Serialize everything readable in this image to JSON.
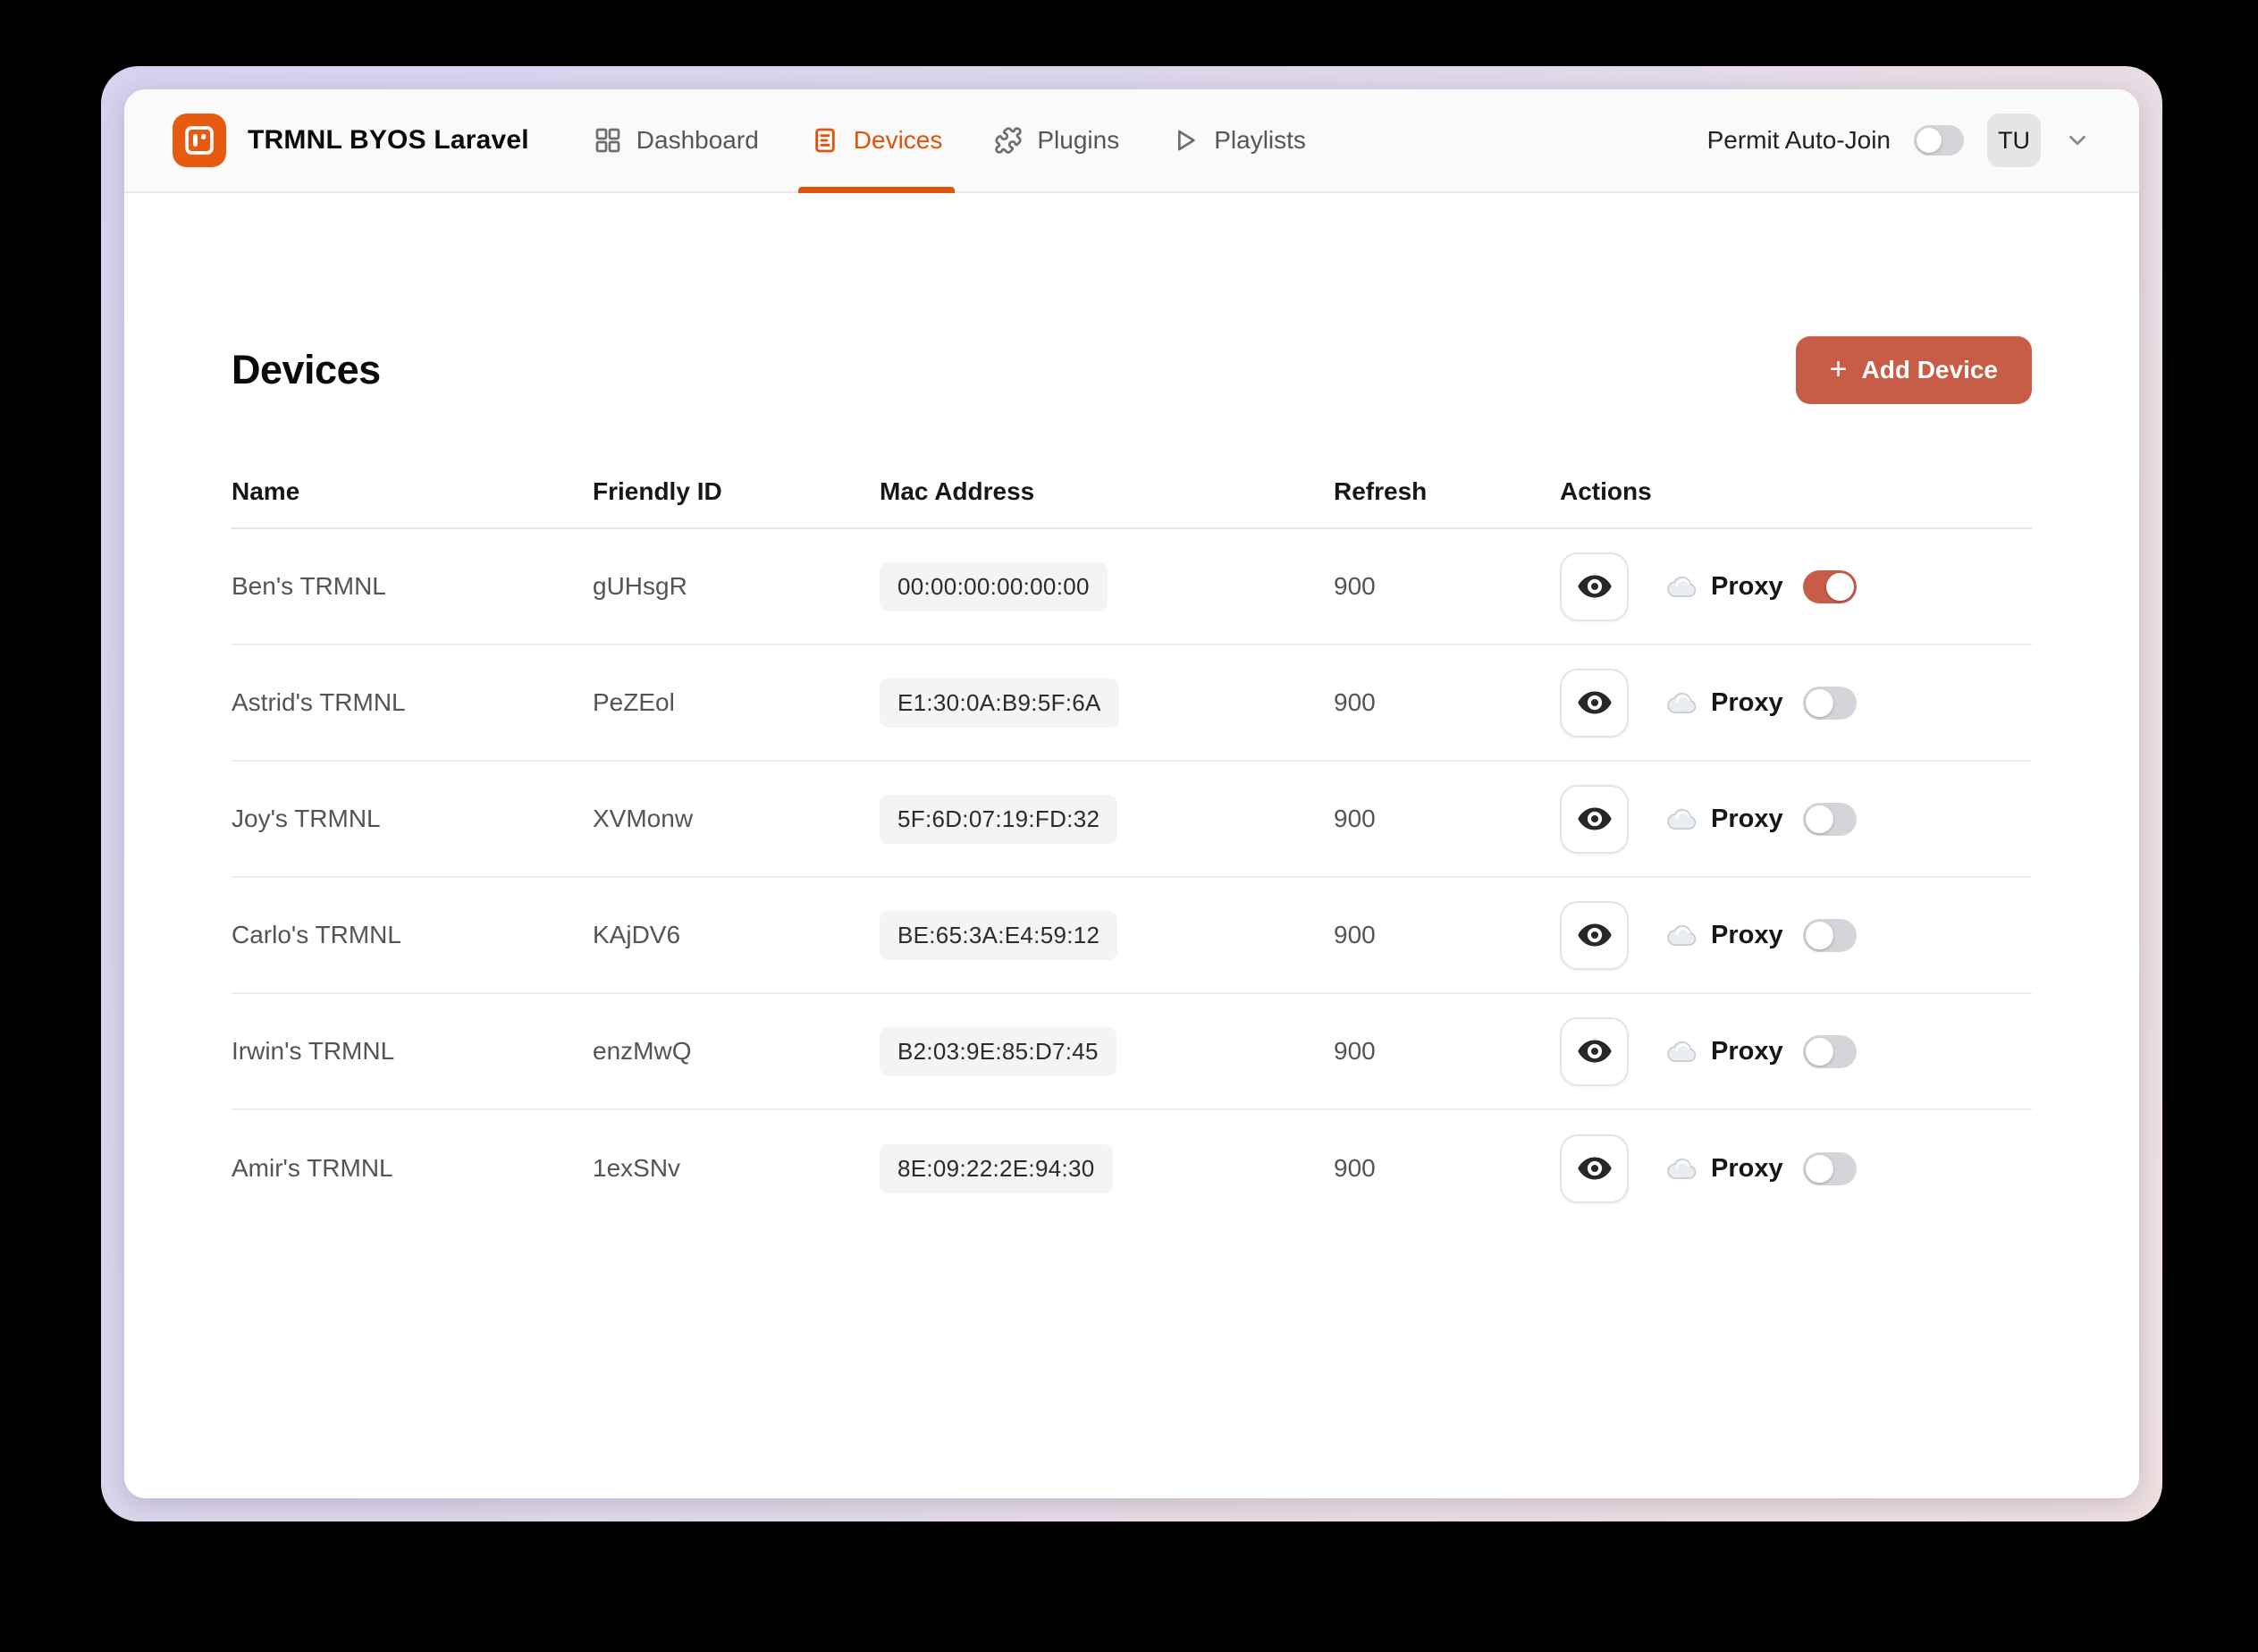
{
  "app": {
    "title": "TRMNL BYOS Laravel"
  },
  "nav": {
    "items": [
      {
        "label": "Dashboard",
        "icon": "grid-icon",
        "active": false
      },
      {
        "label": "Devices",
        "icon": "device-list-icon",
        "active": true
      },
      {
        "label": "Plugins",
        "icon": "puzzle-icon",
        "active": false
      },
      {
        "label": "Playlists",
        "icon": "play-icon",
        "active": false
      }
    ]
  },
  "header_right": {
    "permit_auto_join_label": "Permit Auto-Join",
    "permit_auto_join_on": false,
    "avatar_initials": "TU"
  },
  "page": {
    "title": "Devices",
    "add_device_label": "Add Device",
    "add_device_plus": "+"
  },
  "table": {
    "columns": [
      "Name",
      "Friendly ID",
      "Mac Address",
      "Refresh",
      "Actions"
    ],
    "proxy_label": "Proxy",
    "rows": [
      {
        "name": "Ben's TRMNL",
        "friendly_id": "gUHsgR",
        "mac": "00:00:00:00:00:00",
        "refresh": "900",
        "proxy_on": true
      },
      {
        "name": "Astrid's TRMNL",
        "friendly_id": "PeZEol",
        "mac": "E1:30:0A:B9:5F:6A",
        "refresh": "900",
        "proxy_on": false
      },
      {
        "name": "Joy's TRMNL",
        "friendly_id": "XVMonw",
        "mac": "5F:6D:07:19:FD:32",
        "refresh": "900",
        "proxy_on": false
      },
      {
        "name": "Carlo's TRMNL",
        "friendly_id": "KAjDV6",
        "mac": "BE:65:3A:E4:59:12",
        "refresh": "900",
        "proxy_on": false
      },
      {
        "name": "Irwin's TRMNL",
        "friendly_id": "enzMwQ",
        "mac": "B2:03:9E:85:D7:45",
        "refresh": "900",
        "proxy_on": false
      },
      {
        "name": "Amir's TRMNL",
        "friendly_id": "1exSNv",
        "mac": "8E:09:22:2E:94:30",
        "refresh": "900",
        "proxy_on": false
      }
    ]
  },
  "colors": {
    "accent_orange": "#e05409",
    "logo_orange": "#e65b0f",
    "terracotta": "#c75d46",
    "toggle_off": "#d5d5d9",
    "badge_bg": "#f4f4f5",
    "topbar_bg": "#fafafa",
    "frame_gradient_start": "#d7d3ee",
    "frame_gradient_end": "#eee0e1"
  }
}
